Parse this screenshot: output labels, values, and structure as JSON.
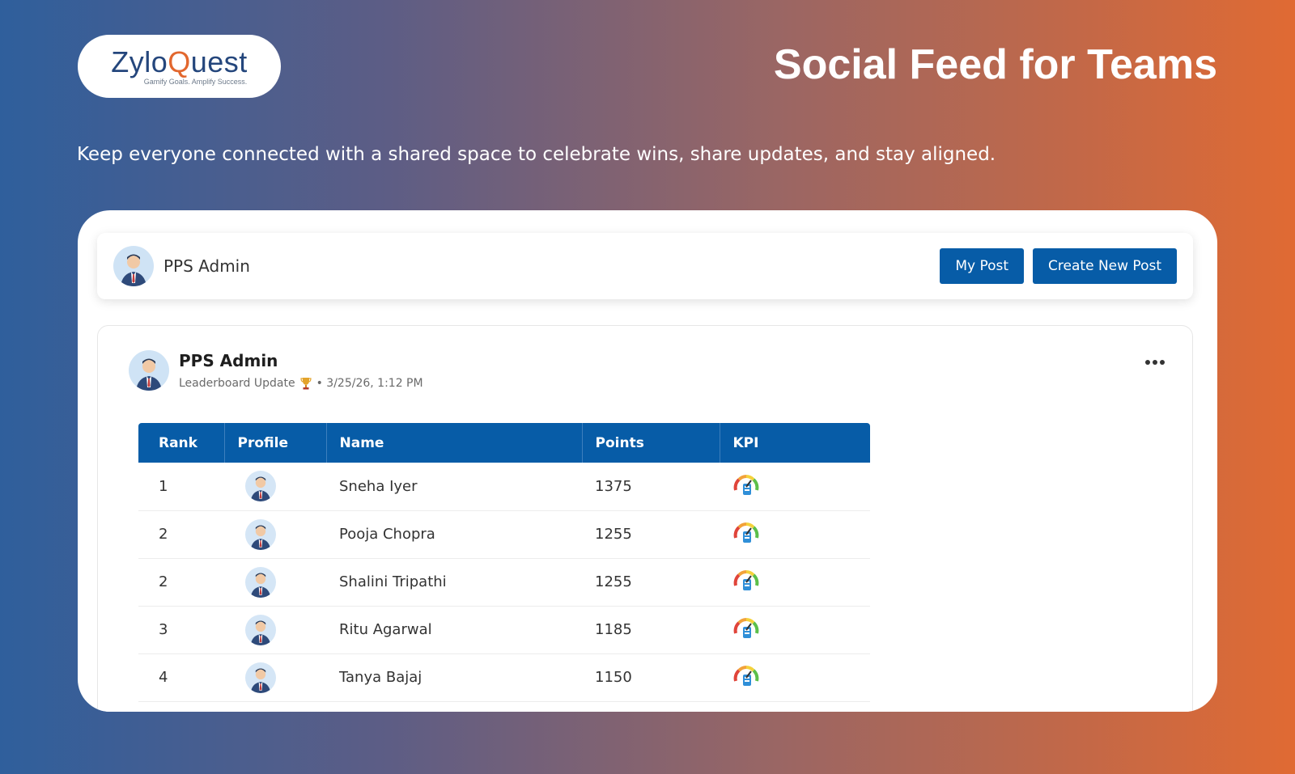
{
  "brand": {
    "logo_part1": "Zylo",
    "logo_q": "Q",
    "logo_part2": "uest",
    "tagline": "Gamify Goals. Amplify Success."
  },
  "hero": {
    "title": "Social Feed for Teams",
    "subtitle": "Keep everyone connected with a shared space to celebrate wins, share updates, and stay aligned."
  },
  "topbar": {
    "user": "PPS Admin",
    "my_post_label": "My Post",
    "create_post_label": "Create New Post"
  },
  "post": {
    "author": "PPS Admin",
    "category": "Leaderboard Update",
    "timestamp": "• 3/25/26, 1:12 PM",
    "table": {
      "headers": [
        "Rank",
        "Profile",
        "Name",
        "Points",
        "KPI"
      ],
      "rows": [
        {
          "rank": "1",
          "name": "Sneha Iyer",
          "points": "1375"
        },
        {
          "rank": "2",
          "name": "Pooja Chopra",
          "points": "1255"
        },
        {
          "rank": "2",
          "name": "Shalini Tripathi",
          "points": "1255"
        },
        {
          "rank": "3",
          "name": "Ritu Agarwal",
          "points": "1185"
        },
        {
          "rank": "4",
          "name": "Tanya Bajaj",
          "points": "1150"
        }
      ]
    }
  },
  "colors": {
    "primary": "#075ca7",
    "accent": "#e2672e"
  }
}
